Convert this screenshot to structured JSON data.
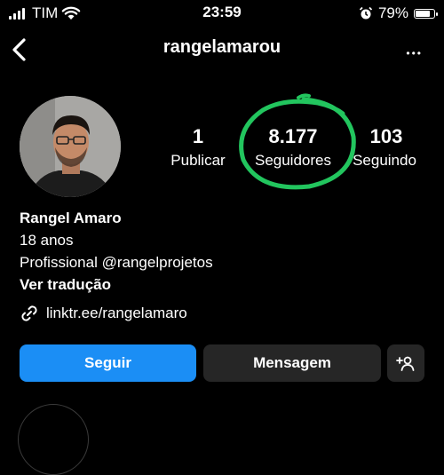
{
  "status_bar": {
    "carrier": "TIM",
    "time": "23:59",
    "battery_percent": "79%",
    "battery_level": 0.79,
    "icons": [
      "signal-icon",
      "wifi-icon",
      "alarm-icon",
      "battery-icon"
    ]
  },
  "header": {
    "username": "rangelamarou",
    "back_icon": "chevron-left-icon",
    "more_icon": "more-horizontal-icon",
    "more_glyph": "•••"
  },
  "profile": {
    "avatar": "profile-photo",
    "stats": {
      "posts": {
        "value": "1",
        "label": "Publicar"
      },
      "followers": {
        "value": "8.177",
        "label": "Seguidores",
        "highlight_color": "#22c55e"
      },
      "following": {
        "value": "103",
        "label": "Seguindo"
      }
    },
    "bio": {
      "name": "Rangel Amaro",
      "line1": "18 anos",
      "line2": "Profissional @rangelprojetos",
      "translate": "Ver tradução"
    },
    "link": {
      "icon": "link-icon",
      "text": "linktr.ee/rangelamaro"
    }
  },
  "actions": {
    "follow_label": "Seguir",
    "message_label": "Mensagem",
    "add_user_icon": "add-user-icon"
  },
  "colors": {
    "background": "#000000",
    "primary": "#1b8ef5",
    "secondary_button": "#262626",
    "annotation": "#22c55e"
  }
}
